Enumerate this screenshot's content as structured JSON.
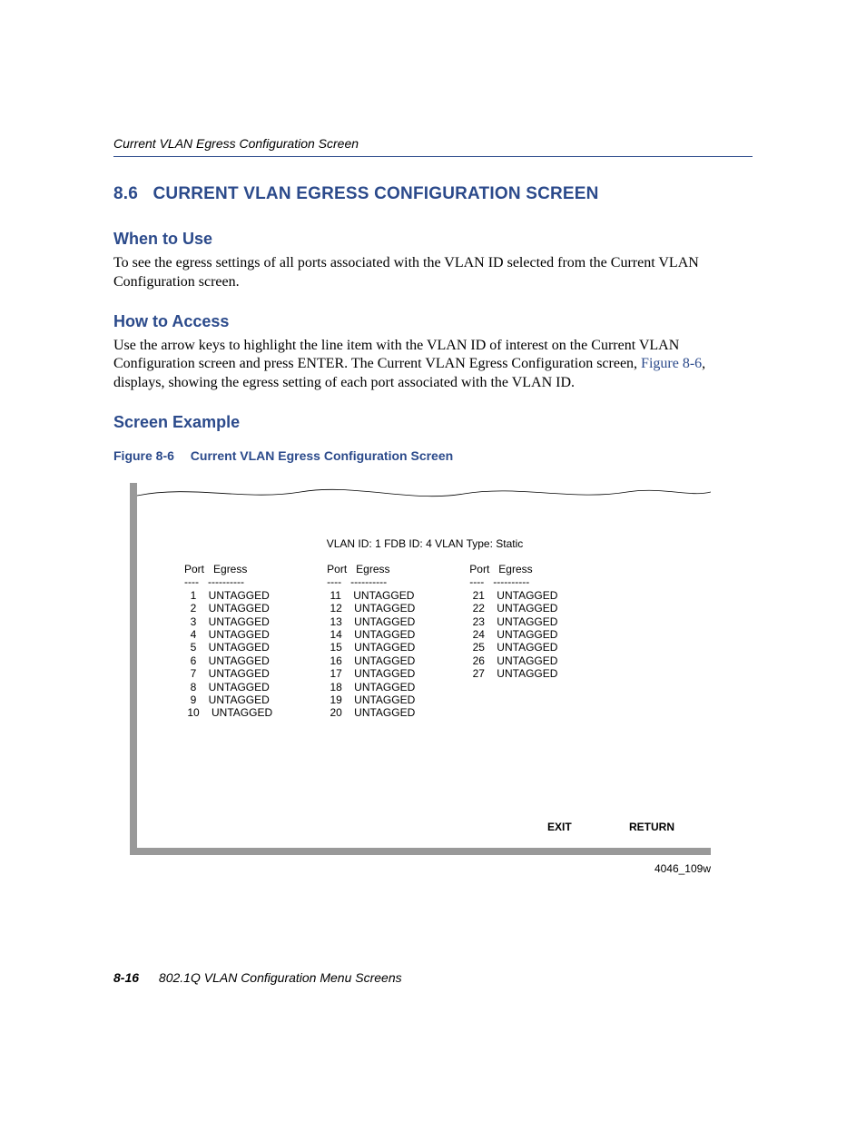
{
  "running_head": "Current VLAN Egress Configuration Screen",
  "heading": {
    "number": "8.6",
    "title": "CURRENT VLAN EGRESS CONFIGURATION SCREEN"
  },
  "sections": {
    "when": {
      "title": "When to Use",
      "body": "To see the egress settings of all ports associated with the VLAN ID selected from the Current VLAN Configuration screen."
    },
    "how": {
      "title": "How to Access",
      "body_pre": "Use the arrow keys to highlight the line item with the VLAN ID of interest on the Current VLAN Configuration screen and press ENTER. The Current VLAN Egress Configuration screen, ",
      "fig_ref": "Figure 8-6",
      "body_post": ", displays, showing the egress setting of each port associated with the VLAN ID."
    },
    "example": {
      "title": "Screen Example"
    }
  },
  "figure": {
    "label": "Figure 8-6",
    "caption": "Current VLAN Egress Configuration Screen",
    "code": "4046_109w"
  },
  "screen": {
    "title": "VLAN ID: 1  FDB ID: 4  VLAN Type: Static",
    "col_header_port": "Port",
    "col_header_egress": "Egress",
    "dashes_port": "----",
    "dashes_egress": "----------",
    "columns": [
      [
        {
          "port": "1",
          "egress": "UNTAGGED"
        },
        {
          "port": "2",
          "egress": "UNTAGGED"
        },
        {
          "port": "3",
          "egress": "UNTAGGED"
        },
        {
          "port": "4",
          "egress": "UNTAGGED"
        },
        {
          "port": "5",
          "egress": "UNTAGGED"
        },
        {
          "port": "6",
          "egress": "UNTAGGED"
        },
        {
          "port": "7",
          "egress": "UNTAGGED"
        },
        {
          "port": "8",
          "egress": "UNTAGGED"
        },
        {
          "port": "9",
          "egress": "UNTAGGED"
        },
        {
          "port": "10",
          "egress": "UNTAGGED"
        }
      ],
      [
        {
          "port": "11",
          "egress": "UNTAGGED"
        },
        {
          "port": "12",
          "egress": "UNTAGGED"
        },
        {
          "port": "13",
          "egress": "UNTAGGED"
        },
        {
          "port": "14",
          "egress": "UNTAGGED"
        },
        {
          "port": "15",
          "egress": "UNTAGGED"
        },
        {
          "port": "16",
          "egress": "UNTAGGED"
        },
        {
          "port": "17",
          "egress": "UNTAGGED"
        },
        {
          "port": "18",
          "egress": "UNTAGGED"
        },
        {
          "port": "19",
          "egress": "UNTAGGED"
        },
        {
          "port": "20",
          "egress": "UNTAGGED"
        }
      ],
      [
        {
          "port": "21",
          "egress": "UNTAGGED"
        },
        {
          "port": "22",
          "egress": "UNTAGGED"
        },
        {
          "port": "23",
          "egress": "UNTAGGED"
        },
        {
          "port": "24",
          "egress": "UNTAGGED"
        },
        {
          "port": "25",
          "egress": "UNTAGGED"
        },
        {
          "port": "26",
          "egress": "UNTAGGED"
        },
        {
          "port": "27",
          "egress": "UNTAGGED"
        }
      ]
    ],
    "actions": {
      "exit": "EXIT",
      "return": "RETURN"
    }
  },
  "footer": {
    "page": "8-16",
    "title": "802.1Q VLAN Configuration Menu Screens"
  }
}
